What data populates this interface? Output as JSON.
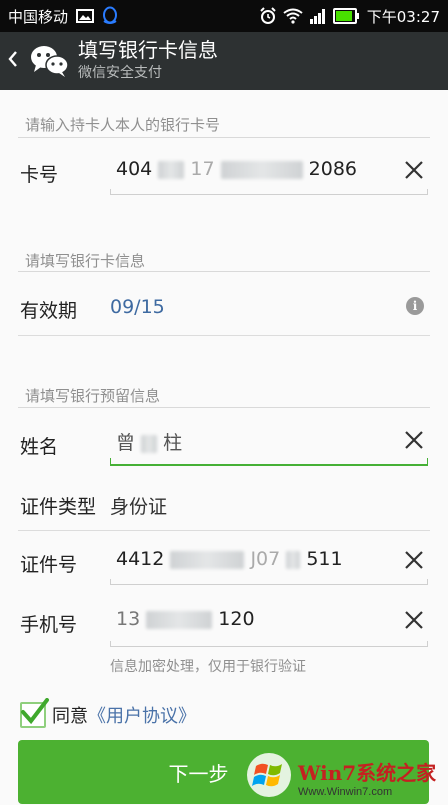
{
  "status_bar": {
    "carrier": "中国移动",
    "time": "下午03:27",
    "icons": [
      "image-icon",
      "qq-icon",
      "alarm-icon",
      "wifi-icon",
      "signal-icon",
      "battery-icon"
    ]
  },
  "header": {
    "title": "填写银行卡信息",
    "subtitle": "微信安全支付",
    "back_icon": "chevron-left-icon",
    "logo_icon": "wechat-icon"
  },
  "sections": {
    "card_section_title": "请输入持卡人本人的银行卡号",
    "bank_info_title": "请填写银行卡信息",
    "reserved_info_title": "请填写银行预留信息"
  },
  "card": {
    "label": "卡号",
    "value_start": "404",
    "value_mid": "17",
    "value_end": "2086"
  },
  "expiry": {
    "label": "有效期",
    "value": "09/15"
  },
  "name": {
    "label": "姓名",
    "value_start": "曾",
    "value_end": "柱"
  },
  "id_type": {
    "label": "证件类型",
    "value": "身份证"
  },
  "id_number": {
    "label": "证件号",
    "value_start": "4412",
    "value_mid": "J07",
    "value_end": "511"
  },
  "phone": {
    "label": "手机号",
    "value_start": "13",
    "value_end": "120",
    "hint": "信息加密处理，仅用于银行验证"
  },
  "agreement": {
    "checked": true,
    "text": "同意",
    "link": "《用户协议》"
  },
  "next_button": {
    "label": "下一步"
  },
  "watermark": {
    "main": "Win7系统之家",
    "url": "Www.Winwin7.com"
  },
  "colors": {
    "accent_green": "#4cb131",
    "header_bg": "#2d3132",
    "link_blue": "#4a72a8",
    "expiry_blue": "#3e6aa1"
  }
}
